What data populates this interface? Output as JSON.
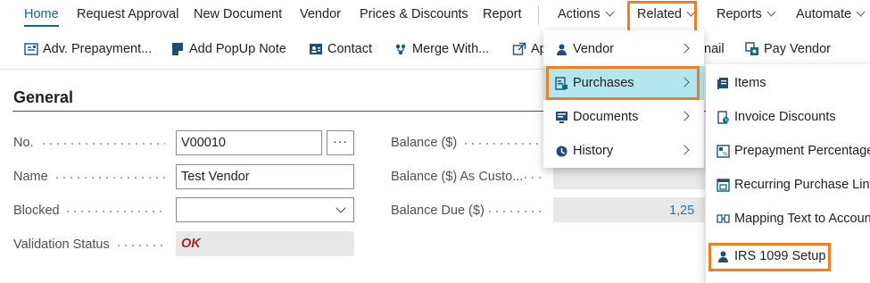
{
  "nav": {
    "home": "Home",
    "request_approval": "Request Approval",
    "new_document": "New Document",
    "vendor": "Vendor",
    "prices_discounts": "Prices & Discounts",
    "report": "Report",
    "actions": "Actions",
    "related": "Related",
    "reports": "Reports",
    "automate": "Automate"
  },
  "actionbar": {
    "adv_prepayment": "Adv. Prepayment...",
    "add_popup_note": "Add PopUp Note",
    "contact": "Contact",
    "merge_with": "Merge With...",
    "ap_partial": "Ap",
    "email_partial": "nail",
    "pay_vendor": "Pay Vendor"
  },
  "general": {
    "title": "General",
    "no_label": "No.",
    "no_value": "V00010",
    "lookup_label": "···",
    "name_label": "Name",
    "name_value": "Test Vendor",
    "blocked_label": "Blocked",
    "blocked_value": "",
    "validation_label": "Validation Status",
    "validation_value": "OK",
    "balance_label": "Balance ($)",
    "balance_customer_label": "Balance ($) As Custo...",
    "balance_due_label": "Balance Due ($)",
    "balance_due_value": "1,25"
  },
  "related_menu": {
    "items": [
      {
        "label": "Vendor",
        "icon": "vendor-icon"
      },
      {
        "label": "Purchases",
        "icon": "purchases-icon"
      },
      {
        "label": "Documents",
        "icon": "documents-icon"
      },
      {
        "label": "History",
        "icon": "history-icon"
      }
    ]
  },
  "purchases_menu": {
    "items": [
      {
        "label": "Items",
        "icon": "items-icon"
      },
      {
        "label": "Invoice Discounts",
        "icon": "invoice-discounts-icon"
      },
      {
        "label": "Prepayment Percentages",
        "icon": "prepayment-percentages-icon"
      },
      {
        "label": "Recurring Purchase Lines",
        "icon": "recurring-purchase-lines-icon"
      },
      {
        "label": "Mapping Text to Account",
        "icon": "mapping-text-icon"
      },
      {
        "label": "IRS 1099 Setup",
        "icon": "irs-1099-icon"
      }
    ]
  },
  "colors": {
    "accent": "#00707a",
    "highlight": "#b3e6ee",
    "callout": "#ef7d22",
    "error": "#a4262c"
  }
}
